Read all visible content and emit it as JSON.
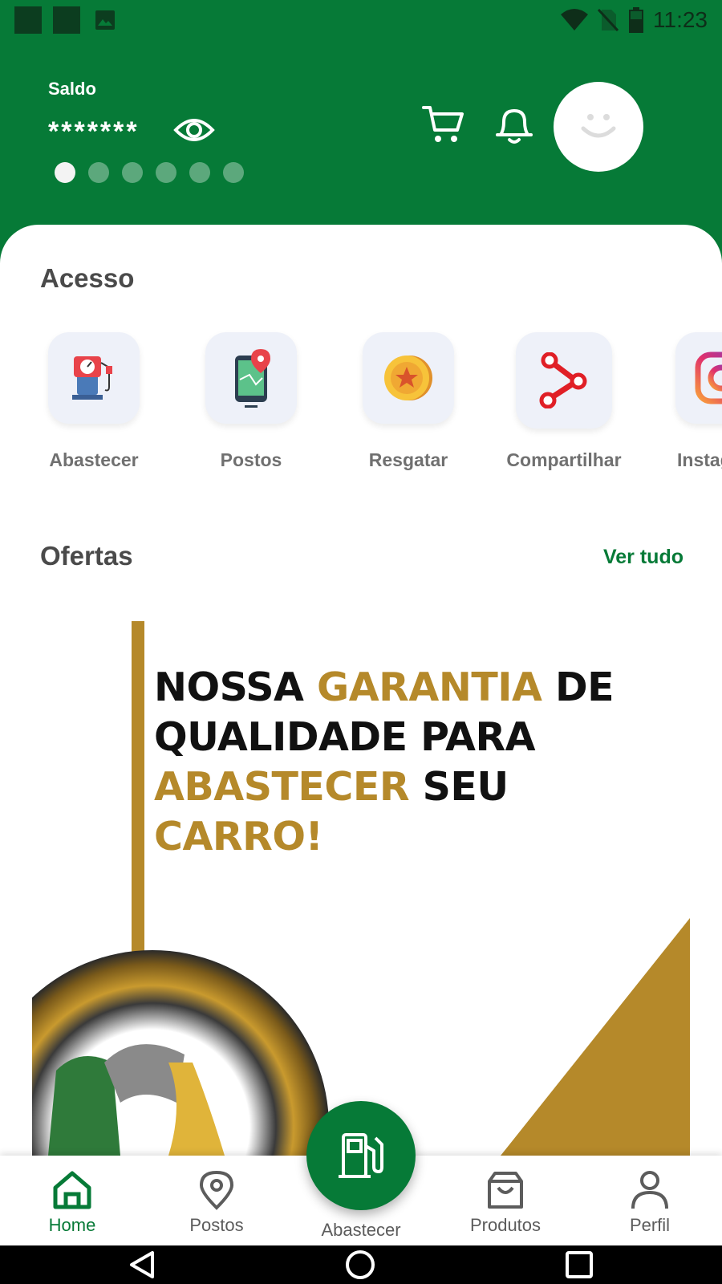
{
  "status_bar": {
    "time": "11:23",
    "icons": [
      "notification-square-icon",
      "notification-square-icon",
      "image-notification-icon",
      "wifi-icon",
      "no-sim-icon",
      "battery-icon"
    ]
  },
  "header": {
    "balance_label": "Saldo",
    "balance_value": "*******",
    "carousel_dots": 6,
    "active_dot": 0,
    "icons": [
      "eye-icon",
      "cart-icon",
      "bell-icon",
      "avatar-smiley-icon"
    ],
    "colors": {
      "brand_green": "#067a37",
      "gold": "#b5892a"
    }
  },
  "acesso": {
    "title": "Acesso",
    "items": [
      {
        "label": "Abastecer",
        "icon": "fuel-pump-icon"
      },
      {
        "label": "Postos",
        "icon": "map-pin-phone-icon"
      },
      {
        "label": "Resgatar",
        "icon": "star-coin-icon"
      },
      {
        "label": "Compartilhar",
        "icon": "share-icon"
      },
      {
        "label": "Instagram",
        "icon": "instagram-icon"
      }
    ]
  },
  "ofertas": {
    "title": "Ofertas",
    "see_all": "Ver tudo",
    "banner": {
      "word1": "NOSSA",
      "word2": "GARANTIA",
      "word3": "DE",
      "line2": "QUALIDADE PARA",
      "word4": "ABASTECER",
      "word5": "SEU",
      "word6": "CARRO!"
    }
  },
  "bottom_nav": {
    "items": [
      {
        "label": "Home",
        "icon": "home-icon",
        "active": true
      },
      {
        "label": "Postos",
        "icon": "location-pin-icon"
      },
      {
        "label": "Abastecer",
        "icon": "fuel-pump-icon"
      },
      {
        "label": "Produtos",
        "icon": "shopping-bag-icon"
      },
      {
        "label": "Perfil",
        "icon": "user-icon"
      }
    ]
  }
}
